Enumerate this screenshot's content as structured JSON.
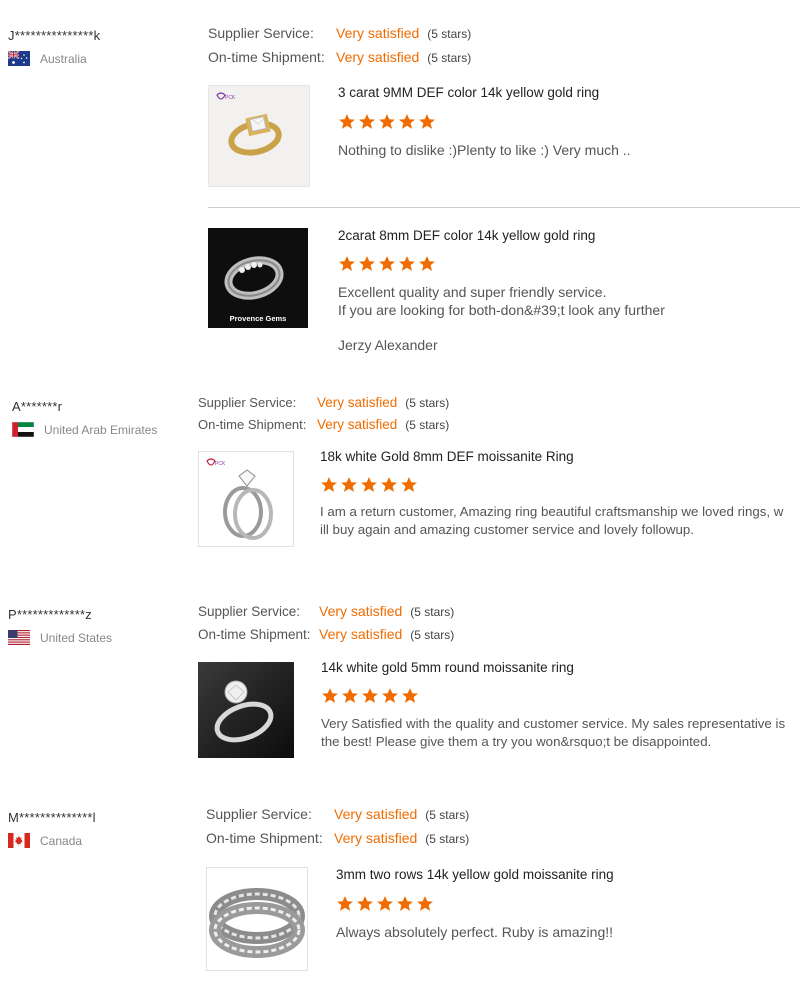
{
  "labels": {
    "supplier_service": "Supplier Service:",
    "ontime_shipment": "On-time Shipment:",
    "very_satisfied": "Very satisfied",
    "five_stars": "(5 stars)"
  },
  "colors": {
    "accent": "#f06c00",
    "divider": "#cccccc"
  },
  "reviews": [
    {
      "buyer": "J***************k",
      "country": "Australia",
      "flag_icon": "australia-flag-icon",
      "items": [
        {
          "title": "3 carat 9MM DEF color 14k yellow gold ring",
          "stars": 5,
          "text": "Nothing to dislike :)Plenty to like :) Very much ..",
          "thumb_icon": "yellow-gold-solitaire-ring-photo"
        },
        {
          "title": "2carat 8mm DEF color 14k yellow gold ring",
          "stars": 5,
          "text_line1": "Excellent quality  and super friendly service.",
          "text_line2": "If you are looking for both-don&#39;t look any further",
          "signature": "Jerzy Alexander",
          "thumb_icon": "band-ring-photo",
          "thumb_caption": "Provence Gems"
        }
      ]
    },
    {
      "buyer": "A*******r",
      "country": "United Arab Emirates",
      "flag_icon": "uae-flag-icon",
      "items": [
        {
          "title": "18k white Gold 8mm DEF moissanite Ring",
          "stars": 5,
          "text_line1": "I am a return customer, Amazing ring beautiful craftsmanship we loved rings, w",
          "text_line2": "ill buy again and amazing customer service and lovely followup.",
          "thumb_icon": "white-gold-bridal-set-photo"
        }
      ]
    },
    {
      "buyer": "P*************z",
      "country": "United States",
      "flag_icon": "usa-flag-icon",
      "items": [
        {
          "title": "14k white gold 5mm round moissanite ring",
          "stars": 5,
          "text_line1": "Very Satisfied with the quality and customer service. My sales representative is",
          "text_line2": "the best!   Please give them a try you won&rsquo;t be disappointed.",
          "thumb_icon": "white-gold-solitaire-photo"
        }
      ]
    },
    {
      "buyer": "M**************l",
      "country": "Canada",
      "flag_icon": "canada-flag-icon",
      "items": [
        {
          "title": "3mm two rows 14k yellow gold moissanite ring",
          "stars": 5,
          "text": "Always absolutely perfect. Ruby is amazing!!",
          "thumb_icon": "two-row-moissanite-band-photo"
        }
      ]
    }
  ]
}
